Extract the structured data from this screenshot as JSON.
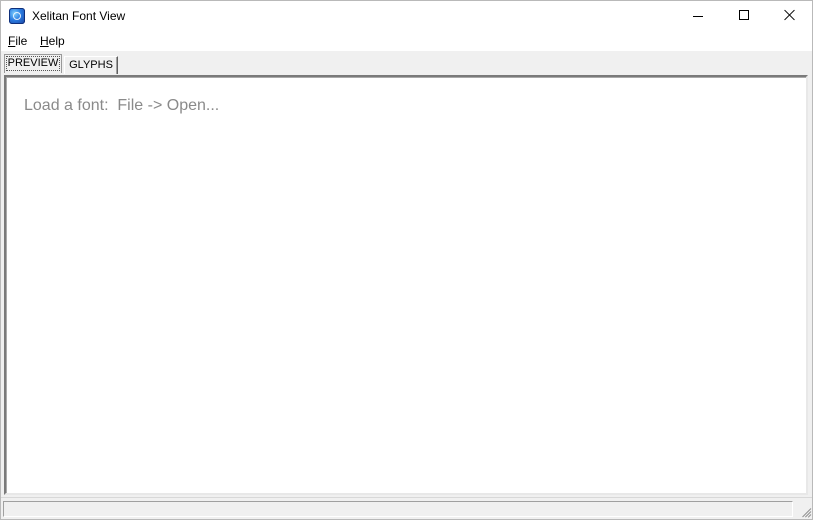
{
  "window": {
    "title": "Xelitan Font View",
    "icon": "app-globe-icon"
  },
  "menu": {
    "file_label": "F",
    "file_label_rest": "ile",
    "help_label": "H",
    "help_label_rest": "elp"
  },
  "tabs": [
    {
      "label": "PREVIEW",
      "selected": true
    },
    {
      "label": "GLYPHS",
      "selected": false
    }
  ],
  "preview": {
    "placeholder": "Load a font:  File -> Open..."
  },
  "status": {
    "text": ""
  },
  "colors": {
    "title_bg": "#ffffff",
    "window_bg": "#f0f0f0",
    "placeholder_text": "#8a8a8a"
  }
}
